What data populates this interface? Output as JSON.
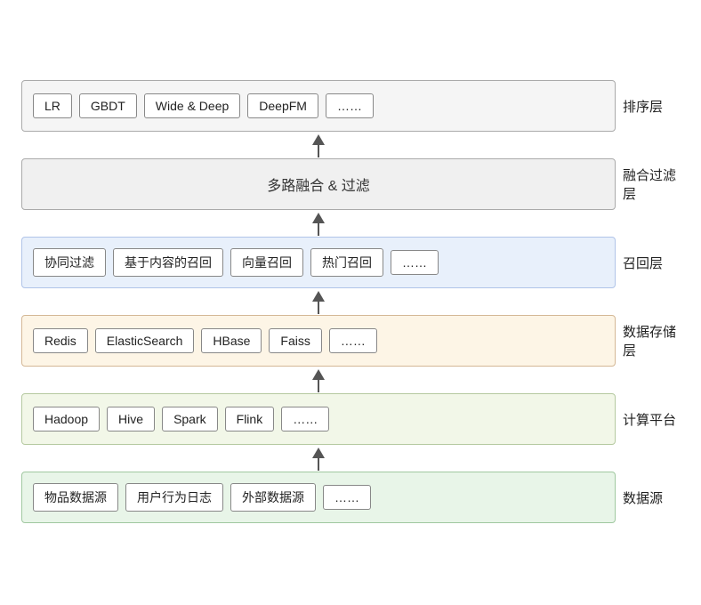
{
  "layers": [
    {
      "id": "paix",
      "label": "排序层",
      "colorClass": "layer-paix",
      "type": "items",
      "items": [
        "LR",
        "GBDT",
        "Wide & Deep",
        "DeepFM",
        "……"
      ]
    },
    {
      "id": "ronghe",
      "label": "融合过滤层",
      "colorClass": "layer-ronghe",
      "type": "center",
      "centerText": "多路融合 & 过滤"
    },
    {
      "id": "zhaohu",
      "label": "召回层",
      "colorClass": "layer-zhaohu",
      "type": "items",
      "items": [
        "协同过滤",
        "基于内容的召回",
        "向量召回",
        "热门召回",
        "……"
      ]
    },
    {
      "id": "cun",
      "label": "数据存储层",
      "colorClass": "layer-cun",
      "type": "items",
      "items": [
        "Redis",
        "ElasticSearch",
        "HBase",
        "Faiss",
        "……"
      ]
    },
    {
      "id": "calc",
      "label": "计算平台",
      "colorClass": "layer-calc",
      "type": "items",
      "items": [
        "Hadoop",
        "Hive",
        "Spark",
        "Flink",
        "……"
      ]
    },
    {
      "id": "datasrc",
      "label": "数据源",
      "colorClass": "layer-data",
      "type": "items",
      "items": [
        "物品数据源",
        "用户行为日志",
        "外部数据源",
        "……"
      ]
    }
  ]
}
